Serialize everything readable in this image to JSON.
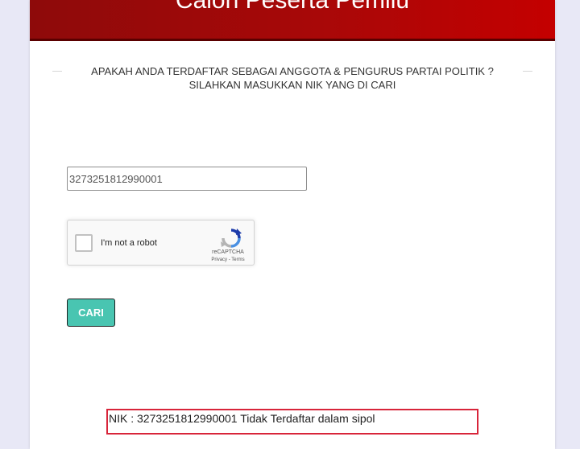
{
  "header": {
    "title": "Calon Peserta Pemilu"
  },
  "question": {
    "line1": "APAKAH ANDA TERDAFTAR SEBAGAI ANGGOTA & PENGURUS PARTAI POLITIK ?",
    "line2": "SILAHKAN MASUKKAN NIK YANG DI CARI"
  },
  "form": {
    "nik_value": "3273251812990001",
    "recaptcha": {
      "label": "I'm not a robot",
      "brand": "reCAPTCHA",
      "links": "Privacy - Terms",
      "checked": false
    },
    "submit_label": "CARI"
  },
  "result": {
    "message": "NIK : 3273251812990001 Tidak Terdaftar dalam sipol"
  },
  "colors": {
    "header_start": "#8e0a0a",
    "header_end": "#c40000",
    "button": "#49c5b1",
    "result_border": "#d8253a",
    "background": "#e8e8f6"
  }
}
